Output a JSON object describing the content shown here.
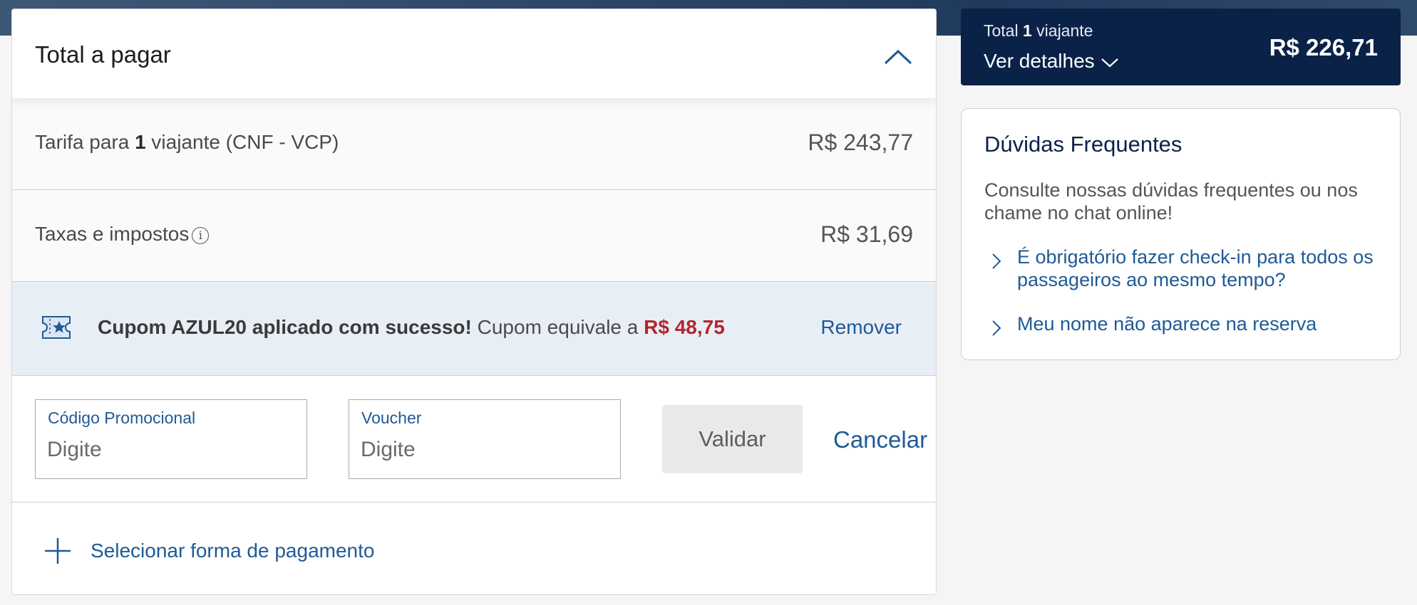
{
  "order": {
    "title": "Total a pagar",
    "fare": {
      "label_prefix": "Tarifa para ",
      "travelers": "1",
      "label_suffix": " viajante (CNF - VCP)",
      "amount": "R$ 243,77"
    },
    "taxes": {
      "label": "Taxas e impostos",
      "info_symbol": "i",
      "amount": "R$ 31,69"
    },
    "coupon": {
      "success_text": "Cupom AZUL20 aplicado com sucesso!",
      "equivalent_text": " Cupom equivale a ",
      "discount": "R$ 48,75",
      "remove_label": "Remover"
    },
    "promo": {
      "promo_label": "Código Promocional",
      "promo_placeholder": "Digite",
      "voucher_label": "Voucher",
      "voucher_placeholder": "Digite",
      "validate_label": "Validar",
      "cancel_label": "Cancelar"
    },
    "payment": {
      "label": "Selecionar forma de pagamento"
    }
  },
  "summary": {
    "travelers_prefix": "Total ",
    "travelers": "1",
    "travelers_suffix": " viajante",
    "details_label": "Ver detalhes",
    "total": "R$ 226,71"
  },
  "faq": {
    "title": "Dúvidas Frequentes",
    "description": "Consulte nossas dúvidas frequentes ou nos chame no chat online!",
    "items": [
      {
        "label": "É obrigatório fazer check-in para todos os passageiros ao mesmo tempo?"
      },
      {
        "label": "Meu nome não aparece na reserva"
      }
    ]
  },
  "colors": {
    "brand_navy": "#0b2248",
    "link_blue": "#1f5a96",
    "discount_red": "#b3262d",
    "coupon_bg": "#e8eef6"
  },
  "icons": [
    "chevron-up-icon",
    "info-icon",
    "ticket-star-icon",
    "plus-icon",
    "chevron-down-icon",
    "chevron-right-icon"
  ]
}
